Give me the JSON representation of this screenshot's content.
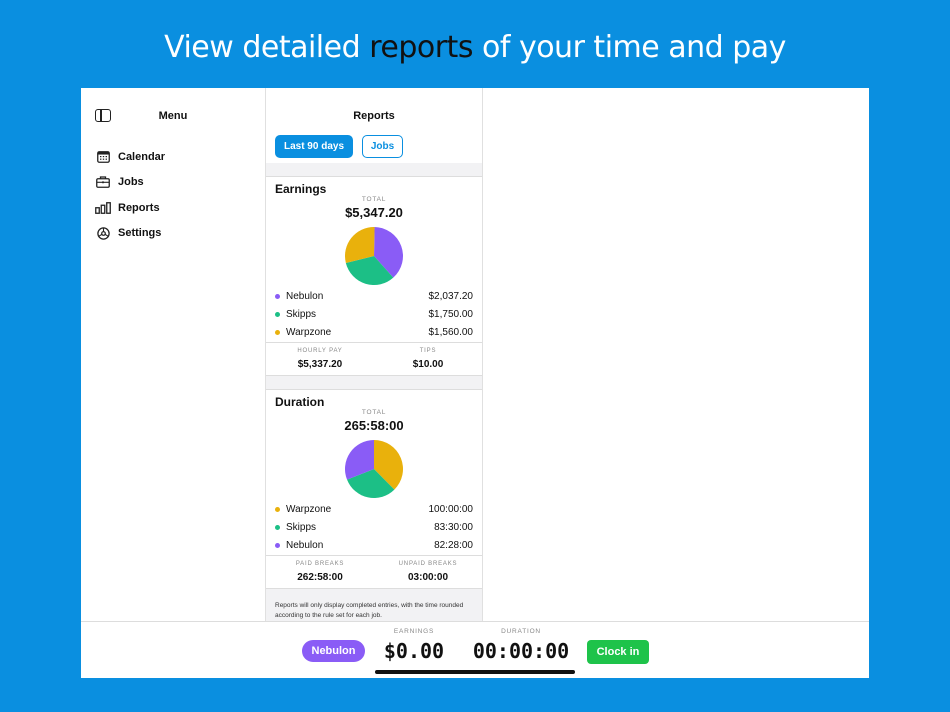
{
  "headline": {
    "before": "View detailed ",
    "highlight": "reports",
    "after": " of your time and pay"
  },
  "sidebar": {
    "title": "Menu",
    "items": [
      {
        "label": "Calendar",
        "icon": "calendar-icon"
      },
      {
        "label": "Jobs",
        "icon": "briefcase-icon"
      },
      {
        "label": "Reports",
        "icon": "bar-chart-icon"
      },
      {
        "label": "Settings",
        "icon": "gear-icon"
      }
    ]
  },
  "reports": {
    "title": "Reports",
    "filters": {
      "range": "Last 90 days",
      "group": "Jobs"
    },
    "earnings": {
      "title": "Earnings",
      "total_label": "TOTAL",
      "total": "$5,347.20",
      "legend": [
        {
          "name": "Nebulon",
          "value": "$2,037.20",
          "color": "#8a5cf6"
        },
        {
          "name": "Skipps",
          "value": "$1,750.00",
          "color": "#1cbf86"
        },
        {
          "name": "Warpzone",
          "value": "$1,560.00",
          "color": "#e9b10c"
        }
      ],
      "stats": [
        {
          "label": "HOURLY PAY",
          "value": "$5,337.20"
        },
        {
          "label": "TIPS",
          "value": "$10.00"
        }
      ]
    },
    "duration": {
      "title": "Duration",
      "total_label": "TOTAL",
      "total": "265:58:00",
      "legend": [
        {
          "name": "Warpzone",
          "value": "100:00:00",
          "color": "#e9b10c"
        },
        {
          "name": "Skipps",
          "value": "83:30:00",
          "color": "#1cbf86"
        },
        {
          "name": "Nebulon",
          "value": "82:28:00",
          "color": "#8a5cf6"
        }
      ],
      "stats": [
        {
          "label": "PAID BREAKS",
          "value": "262:58:00"
        },
        {
          "label": "UNPAID BREAKS",
          "value": "03:00:00"
        }
      ]
    },
    "footnote": "Reports will only display completed entries, with the time rounded according to the rule set for each job."
  },
  "chart_data": [
    {
      "type": "pie",
      "title": "Earnings",
      "categories": [
        "Nebulon",
        "Skipps",
        "Warpzone"
      ],
      "values": [
        2037.2,
        1750.0,
        1560.0
      ],
      "colors": [
        "#8a5cf6",
        "#1cbf86",
        "#e9b10c"
      ]
    },
    {
      "type": "pie",
      "title": "Duration",
      "categories": [
        "Warpzone",
        "Skipps",
        "Nebulon"
      ],
      "values": [
        100.0,
        83.5,
        82.4667
      ],
      "colors": [
        "#e9b10c",
        "#1cbf86",
        "#8a5cf6"
      ]
    }
  ],
  "bottom_bar": {
    "job": "Nebulon",
    "earnings_label": "EARNINGS",
    "earnings": "$0.00",
    "duration_label": "DURATION",
    "duration": "00:00:00",
    "clock_in": "Clock in"
  },
  "colors": {
    "accent": "#0a8fe0",
    "nebulon": "#8a5cf6",
    "skipps": "#1cbf86",
    "warpzone": "#e9b10c",
    "clock_in": "#1ec34a"
  }
}
